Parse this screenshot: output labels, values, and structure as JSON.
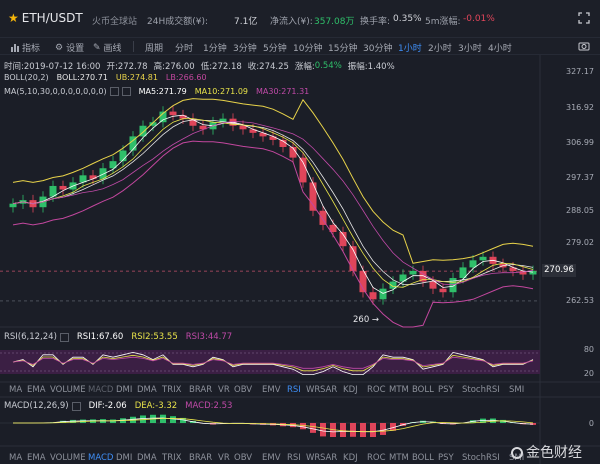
{
  "header": {
    "pair": "ETH/USDT",
    "exchange": "火币全球站",
    "vol_label": "24H成交额(¥):",
    "vol_value": "7.1亿",
    "netflow_label": "净流入(¥):",
    "netflow_value": "357.08万",
    "turnover_label": "换手率:",
    "turnover_value": "0.35%",
    "change5m_label": "5m涨幅:",
    "change5m_value": "-0.01%"
  },
  "toolbar": {
    "indicator": "指标",
    "settings": "设置",
    "draw": "画线",
    "period_label": "周期",
    "periods": [
      "分时",
      "1分钟",
      "3分钟",
      "5分钟",
      "10分钟",
      "15分钟",
      "30分钟",
      "1小时",
      "2小时",
      "3小时",
      "4小时"
    ],
    "active_period": "1小时"
  },
  "info": {
    "time": "时间:2019-07-12 16:00",
    "open": "开:272.78",
    "high": "高:276.00",
    "low": "低:272.18",
    "close": "收:274.25",
    "change_label": "涨幅:",
    "change_value": "0.54%",
    "amp": "振幅:1.40%"
  },
  "boll_legend": {
    "name": "BOLL(20,2)",
    "boll": "BOLL:270.71",
    "ub": "UB:274.81",
    "lb": "LB:266.60"
  },
  "ma_legend": {
    "name": "MA(5,10,30,0,0,0,0,0,0,0)",
    "ma5": "MA5:271.79",
    "ma10": "MA10:271.09",
    "ma30": "MA30:271.31"
  },
  "rsi_legend": {
    "name": "RSI(6,12,24)",
    "rsi1": "RSI1:67.60",
    "rsi2": "RSI2:53.55",
    "rsi3": "RSI3:44.77"
  },
  "macd_legend": {
    "name": "MACD(12,26,9)",
    "dif": "DIF:-2.06",
    "dea": "DEA:-3.32",
    "macd": "MACD:2.53"
  },
  "indicator_tabs": [
    "MA",
    "EMA",
    "VOLUME",
    "MACD",
    "DMI",
    "DMA",
    "TRIX",
    "BRAR",
    "VR",
    "OBV",
    "EMV",
    "RSI",
    "WR",
    "SAR",
    "KDJ",
    "ROC",
    "MTM",
    "BOLL",
    "PSY",
    "StochRSI",
    "SMI"
  ],
  "chart_data": [
    {
      "type": "candlestick",
      "y_ticks": [
        327.17,
        316.92,
        306.99,
        297.37,
        288.05,
        279.02,
        270.96,
        262.53
      ],
      "ylim": [
        258,
        330
      ],
      "current_price": "270.96",
      "low_marker": "260",
      "close": [
        290,
        291,
        289,
        292,
        295,
        294,
        296,
        298,
        297,
        300,
        302,
        305,
        309,
        312,
        313,
        316,
        315,
        314,
        312,
        311,
        313,
        314,
        312,
        311,
        310,
        309,
        308,
        306,
        303,
        296,
        288,
        284,
        282,
        278,
        271,
        265,
        263,
        266,
        268,
        270,
        271,
        268,
        266,
        265,
        269,
        272,
        274,
        275,
        273,
        272,
        271,
        270,
        271
      ]
    },
    {
      "type": "line",
      "name": "RSI",
      "y_ticks": [
        80.0,
        20.0
      ],
      "ylim": [
        0,
        100
      ]
    },
    {
      "type": "bar",
      "name": "MACD",
      "y_ticks": [
        0.0
      ],
      "ylim": [
        -10,
        10
      ]
    }
  ],
  "colors": {
    "up": "#2fbf6a",
    "down": "#e0455a",
    "boll": "#e8e8e8",
    "ub": "#e8d34a",
    "lb": "#c2479e",
    "ma5": "#ffffff",
    "ma10": "#e8e34a",
    "ma30": "#c04aa8",
    "accent": "#3f8ef5"
  },
  "watermark": "金色财经"
}
